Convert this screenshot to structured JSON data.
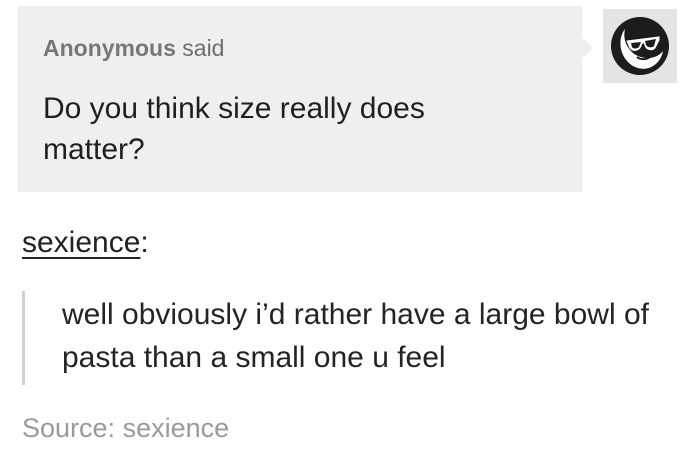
{
  "ask": {
    "asker": "Anonymous",
    "said_label": "said",
    "question": "Do you think size really does matter?"
  },
  "avatar": {
    "icon": "sunglasses-face-icon"
  },
  "answer": {
    "author": "sexience",
    "colon": ":",
    "text": "well obviously i’d rather have a large bowl of pasta than a small one u feel"
  },
  "source": {
    "label": "Source:",
    "name": "sexience"
  },
  "colors": {
    "ask_background": "#efefef",
    "quote_bar": "#d2d2d2",
    "source_text": "#9a9a9a"
  }
}
